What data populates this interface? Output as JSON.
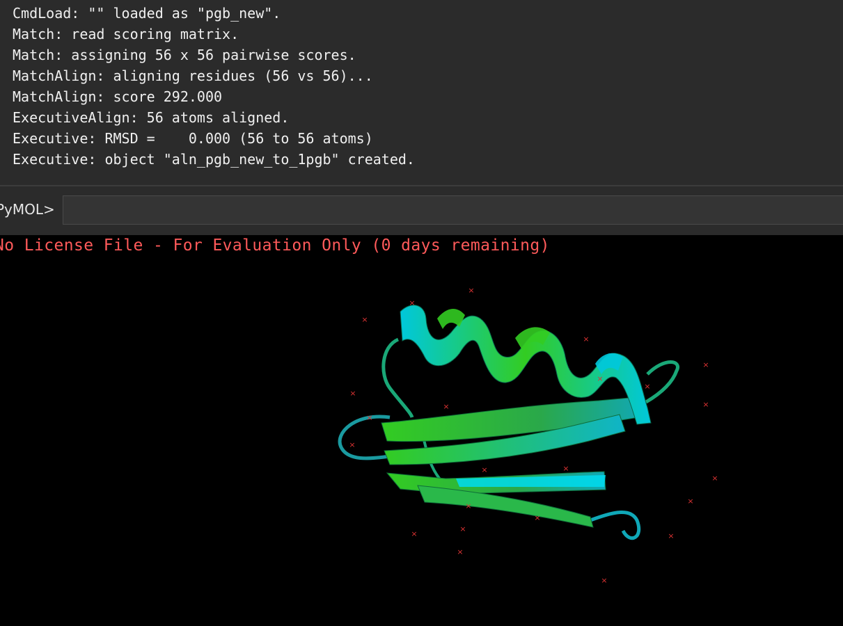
{
  "log": {
    "lines": [
      "CmdLoad: \"\" loaded as \"pgb_new\".",
      "Match: read scoring matrix.",
      "Match: assigning 56 x 56 pairwise scores.",
      "MatchAlign: aligning residues (56 vs 56)...",
      "MatchAlign: score 292.000",
      "ExecutiveAlign: 56 atoms aligned.",
      "Executive: RMSD =    0.000 (56 to 56 atoms)",
      "Executive: object \"aln_pgb_new_to_1pgb\" created."
    ]
  },
  "command": {
    "prompt": "PyMOL>",
    "value": ""
  },
  "viewer": {
    "license_text": "No License File - For Evaluation Only (0 days remaining)",
    "colors": {
      "background": "#000000",
      "license": "#ff5a5a",
      "structure_green": "#33cc22",
      "structure_cyan": "#00c8dc",
      "water": "#dd3333"
    }
  }
}
